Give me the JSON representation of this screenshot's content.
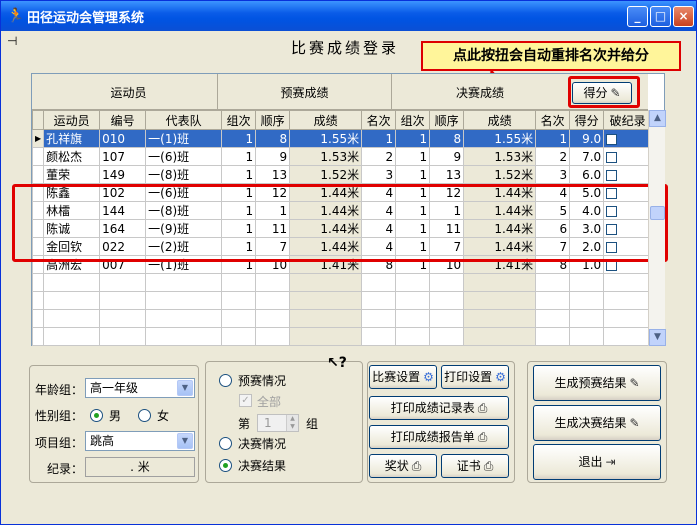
{
  "window": {
    "title": "田径运动会管理系统",
    "min": "_",
    "max": "□",
    "close": "×"
  },
  "heading": "比赛成绩登录",
  "callout": "点此按扭会自动重排名次并给分",
  "grid": {
    "group_headers": [
      "运动员",
      "预赛成绩",
      "决赛成绩"
    ],
    "score_button": "得分",
    "columns": [
      "运动员",
      "编号",
      "代表队",
      "组次",
      "顺序",
      "成绩",
      "名次",
      "组次",
      "顺序",
      "成绩",
      "名次",
      "得分",
      "破纪录"
    ],
    "rows": [
      [
        "孔祥旗",
        "010",
        "一(1)班",
        "1",
        "8",
        "1.55米",
        "1",
        "1",
        "8",
        "1.55米",
        "1",
        "9.0"
      ],
      [
        "颜松杰",
        "107",
        "一(6)班",
        "1",
        "9",
        "1.53米",
        "2",
        "1",
        "9",
        "1.53米",
        "2",
        "7.0"
      ],
      [
        "董荣",
        "149",
        "一(8)班",
        "1",
        "13",
        "1.52米",
        "3",
        "1",
        "13",
        "1.52米",
        "3",
        "6.0"
      ],
      [
        "陈鑫",
        "102",
        "一(6)班",
        "1",
        "12",
        "1.44米",
        "4",
        "1",
        "12",
        "1.44米",
        "4",
        "5.0"
      ],
      [
        "林檑",
        "144",
        "一(8)班",
        "1",
        "1",
        "1.44米",
        "4",
        "1",
        "1",
        "1.44米",
        "5",
        "4.0"
      ],
      [
        "陈诚",
        "164",
        "一(9)班",
        "1",
        "11",
        "1.44米",
        "4",
        "1",
        "11",
        "1.44米",
        "6",
        "3.0"
      ],
      [
        "金回钦",
        "022",
        "一(2)班",
        "1",
        "7",
        "1.44米",
        "4",
        "1",
        "7",
        "1.44米",
        "7",
        "2.0"
      ],
      [
        "高洲宏",
        "007",
        "一(1)班",
        "1",
        "10",
        "1.41米",
        "8",
        "1",
        "10",
        "1.41米",
        "8",
        "1.0"
      ]
    ],
    "selected_row": 0,
    "highlighted_rows": "4-7"
  },
  "filters": {
    "age_label": "年龄组：",
    "age_value": "高一年级",
    "gender_label": "性别组：",
    "male": "男",
    "female": "女",
    "gender_selected": "男",
    "event_label": "项目组：",
    "event_value": "跳高",
    "record_label": "纪录：",
    "record_value": ".    米"
  },
  "stage": {
    "prelim_status": "预赛情况",
    "all": "全部",
    "di": "第",
    "group_num": "1",
    "zu": "组",
    "final_status": "决赛情况",
    "final_result": "决赛结果",
    "selected": "决赛结果"
  },
  "buttons": {
    "match_settings": "比赛设置",
    "print_settings": "打印设置",
    "print_record": "打印成绩记录表",
    "print_report": "打印成绩报告单",
    "award": "奖状",
    "certificate": "证书",
    "gen_prelim": "生成预赛结果",
    "gen_final": "生成决赛结果",
    "exit": "退出"
  },
  "colors": {
    "selected_row": "#316ac5",
    "highlight": "#e00000",
    "callout_bg": "#fff59a"
  }
}
